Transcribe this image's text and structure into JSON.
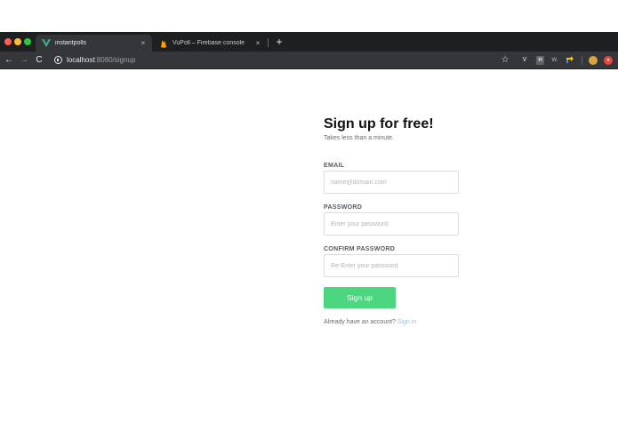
{
  "browser": {
    "tabs": [
      {
        "title": "instantpolls",
        "favicon": "vue-logo-icon",
        "active": true
      },
      {
        "title": "VuPoll – Firebase console",
        "favicon": "firebase-flame-icon",
        "active": false
      }
    ],
    "close_glyph": "×",
    "new_tab_glyph": "+",
    "url_host": "localhost",
    "url_rest": ":8080/signup",
    "extensions": [
      "star-bookmark-icon",
      "vue-devtools-icon",
      "h-extension-icon",
      "w-extension-icon",
      "flag-extension-icon",
      "profile-avatar-icon",
      "red-extension-icon"
    ],
    "ext_labels": {
      "v": "V",
      "h": "H",
      "w": "W."
    }
  },
  "form": {
    "title": "Sign up for free!",
    "subtitle": "Takes less than a minute.",
    "email_label": "EMAIL",
    "email_placeholder": "name@domain.com",
    "password_label": "PASSWORD",
    "password_placeholder": "Enter your password",
    "confirm_label": "CONFIRM PASSWORD",
    "confirm_placeholder": "Re-Enter your password",
    "submit_label": "Sign up",
    "account_prompt": "Already have an account?",
    "signin_label": "Sign in"
  },
  "colors": {
    "accent_green": "#4cd680",
    "link_blue": "#8ec5ea",
    "chrome_dark": "#1e1f21"
  }
}
